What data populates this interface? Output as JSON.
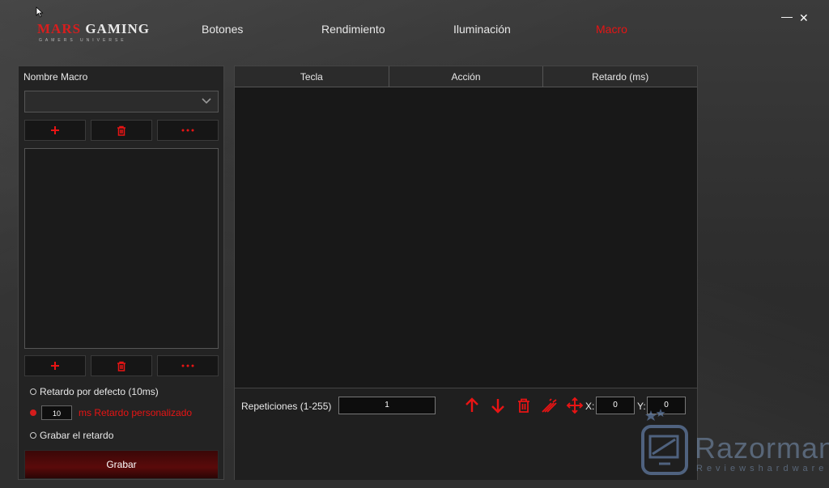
{
  "app": {
    "brand_mars": "MARS",
    "brand_gaming": " GAMING",
    "brand_sub": "GAMERS UNIVERSE"
  },
  "nav": {
    "items": [
      {
        "label": "Botones"
      },
      {
        "label": "Rendimiento"
      },
      {
        "label": "Iluminación"
      },
      {
        "label": "Macro",
        "active": true
      }
    ]
  },
  "window": {
    "minimize": "—",
    "close": "✕"
  },
  "left": {
    "macro_name_label": "Nombre Macro",
    "dropdown_value": "",
    "radios": {
      "default_delay": "Retardo por defecto (10ms)",
      "custom_delay_value": "10",
      "custom_delay_label": "ms Retardo personalizado",
      "record_delay": "Grabar el retardo"
    },
    "record_button": "Grabar"
  },
  "table": {
    "columns": [
      "Tecla",
      "Acción",
      "Retardo (ms)"
    ],
    "rows": []
  },
  "bottom": {
    "repetitions_label": "Repeticiones (1-255)",
    "repetitions_value": "1",
    "x_label": "X:",
    "x_value": "0",
    "y_label": "Y:",
    "y_value": "0"
  },
  "watermark": {
    "name": "Razorman",
    "sub": "Reviewshardware"
  },
  "colors": {
    "accent": "#e81414",
    "background": "#2e2e2e",
    "panel": "#1e1e1e"
  }
}
